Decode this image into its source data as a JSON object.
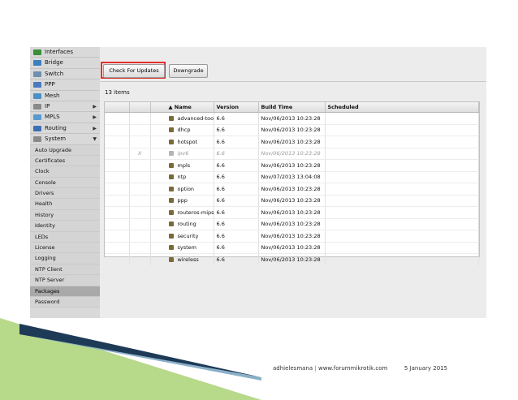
{
  "sidebar": {
    "items": [
      {
        "label": "Interfaces",
        "icon": "interfaces-icon",
        "color": "#3a8f3a",
        "arrow": ""
      },
      {
        "label": "Bridge",
        "icon": "bridge-icon",
        "color": "#3c7fc0",
        "arrow": ""
      },
      {
        "label": "Switch",
        "icon": "switch-icon",
        "color": "#6d8fb0",
        "arrow": ""
      },
      {
        "label": "PPP",
        "icon": "ppp-icon",
        "color": "#4a7ac0",
        "arrow": ""
      },
      {
        "label": "Mesh",
        "icon": "mesh-icon",
        "color": "#4a90c8",
        "arrow": ""
      },
      {
        "label": "IP",
        "icon": "ip-icon",
        "color": "#8a8a8a",
        "arrow": "▶"
      },
      {
        "label": "MPLS",
        "icon": "mpls-icon",
        "color": "#5a9ad0",
        "arrow": "▶"
      },
      {
        "label": "Routing",
        "icon": "routing-icon",
        "color": "#3d6fb5",
        "arrow": "▶"
      },
      {
        "label": "System",
        "icon": "system-icon",
        "color": "#8a8a8a",
        "arrow": "▼"
      }
    ],
    "sub_items": [
      "Auto Upgrade",
      "Certificates",
      "Clock",
      "Console",
      "Drivers",
      "Health",
      "History",
      "Identity",
      "LEDs",
      "License",
      "Logging",
      "NTP Client",
      "NTP Server",
      "Packages",
      "Password"
    ],
    "selected": "Packages"
  },
  "toolbar": {
    "check_label": "Check For Updates",
    "downgrade_label": "Downgrade"
  },
  "count_label": "13 items",
  "table": {
    "columns": [
      "",
      "",
      "▲ Name",
      "Version",
      "Build Time",
      "Scheduled"
    ],
    "rows": [
      {
        "flag": "",
        "name": "advanced-tools",
        "version": "6.6",
        "build": "Nov/06/2013 10:23:28",
        "scheduled": "",
        "disabled": false
      },
      {
        "flag": "",
        "name": "dhcp",
        "version": "6.6",
        "build": "Nov/06/2013 10:23:28",
        "scheduled": "",
        "disabled": false
      },
      {
        "flag": "",
        "name": "hotspot",
        "version": "6.6",
        "build": "Nov/06/2013 10:23:28",
        "scheduled": "",
        "disabled": false
      },
      {
        "flag": "X",
        "name": "ipv6",
        "version": "6.6",
        "build": "Nov/06/2013 10:23:28",
        "scheduled": "",
        "disabled": true
      },
      {
        "flag": "",
        "name": "mpls",
        "version": "6.6",
        "build": "Nov/06/2013 10:23:28",
        "scheduled": "",
        "disabled": false
      },
      {
        "flag": "",
        "name": "ntp",
        "version": "6.6",
        "build": "Nov/07/2013 13:04:08",
        "scheduled": "",
        "disabled": false
      },
      {
        "flag": "",
        "name": "option",
        "version": "6.6",
        "build": "Nov/06/2013 10:23:28",
        "scheduled": "",
        "disabled": false
      },
      {
        "flag": "",
        "name": "ppp",
        "version": "6.6",
        "build": "Nov/06/2013 10:23:28",
        "scheduled": "",
        "disabled": false
      },
      {
        "flag": "",
        "name": "routeros-mipsbe",
        "version": "6.6",
        "build": "Nov/06/2013 10:23:28",
        "scheduled": "",
        "disabled": false
      },
      {
        "flag": "",
        "name": "routing",
        "version": "6.6",
        "build": "Nov/06/2013 10:23:28",
        "scheduled": "",
        "disabled": false
      },
      {
        "flag": "",
        "name": "security",
        "version": "6.6",
        "build": "Nov/06/2013 10:23:28",
        "scheduled": "",
        "disabled": false
      },
      {
        "flag": "",
        "name": "system",
        "version": "6.6",
        "build": "Nov/06/2013 10:23:28",
        "scheduled": "",
        "disabled": false
      },
      {
        "flag": "",
        "name": "wireless",
        "version": "6.6",
        "build": "Nov/06/2013 10:23:28",
        "scheduled": "",
        "disabled": false
      }
    ]
  },
  "footer": {
    "author": "adhielesmana",
    "site": "www.forummikrotik.com",
    "date": "5 January 2015",
    "separator": "|"
  },
  "colors": {
    "highlight": "#e0302a",
    "triangle_dark": "#1d3a57",
    "triangle_light": "#b7d98a"
  }
}
